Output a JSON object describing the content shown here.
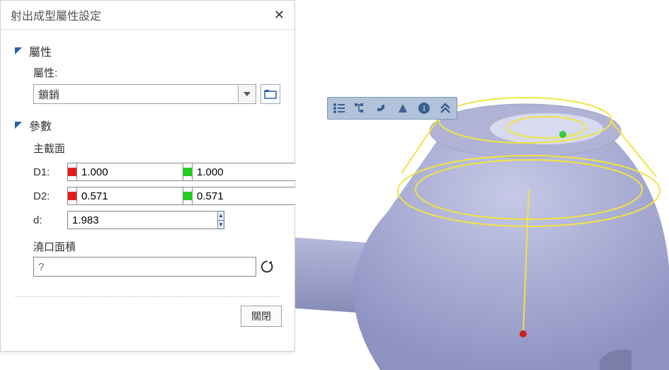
{
  "panel": {
    "title": "射出成型屬性設定"
  },
  "groups": {
    "attr_title": "屬性",
    "attr_label": "屬性:",
    "attr_value": "鎖銷",
    "params_title": "參數",
    "section_label": "主截面"
  },
  "params": {
    "d1_label": "D1:",
    "d1_red": "1.000",
    "d1_green": "1.000",
    "d2_label": "D2:",
    "d2_red": "0.571",
    "d2_green": "0.571",
    "d_label": "d:",
    "d_value": "1.983"
  },
  "area": {
    "label": "澆口面積",
    "value": "?"
  },
  "footer": {
    "close_label": "關閉"
  }
}
